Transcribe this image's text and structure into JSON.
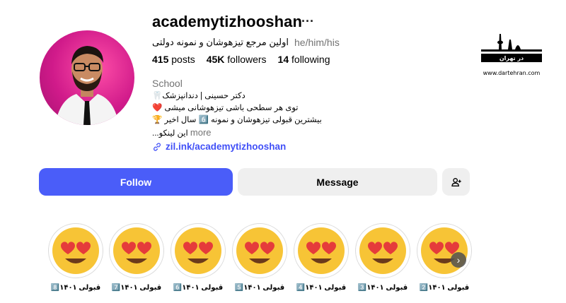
{
  "profile": {
    "username": "academytizhooshan",
    "more_label": "···",
    "tagline": "اولین مرجع تیزهوشان و نمونه دولتی",
    "pronouns": "he/him/his",
    "stats": {
      "posts_count": "415",
      "posts_label": "posts",
      "followers_count": "45K",
      "followers_label": "followers",
      "following_count": "14",
      "following_label": "following"
    },
    "category": "School",
    "bio": {
      "line1": "🦷دکتر حسینی | دندانپزشک",
      "line2": "❤️ توی هر سطحی باشی تیزهوشانی میشی",
      "line3": "🏆 بیشترین قبولی تیزهوشان و نمونه 6️⃣ سال اخیر",
      "line4": "...این لینکو",
      "more": "more"
    },
    "link": "zil.ink/academytizhooshan"
  },
  "actions": {
    "follow": "Follow",
    "message": "Message"
  },
  "highlights": [
    {
      "label": "8️⃣قبولی ۱۴۰۱"
    },
    {
      "label": "7️⃣قبولی ۱۴۰۱"
    },
    {
      "label": "6️⃣قبولی ۱۴۰۱"
    },
    {
      "label": "5️⃣قبولی ۱۴۰۱"
    },
    {
      "label": "4️⃣قبولی ۱۴۰۱"
    },
    {
      "label": "3️⃣قبولی ۱۴۰۱"
    },
    {
      "label": "2️⃣قبولی ۱۴۰۱"
    }
  ],
  "watermark": {
    "logo_text": "در تهران",
    "url": "www.dartehran.com"
  },
  "colors": {
    "follow_blue": "#4a5df9",
    "link_blue": "#4150f7",
    "button_gray": "#efefef",
    "muted_text": "#737373"
  }
}
